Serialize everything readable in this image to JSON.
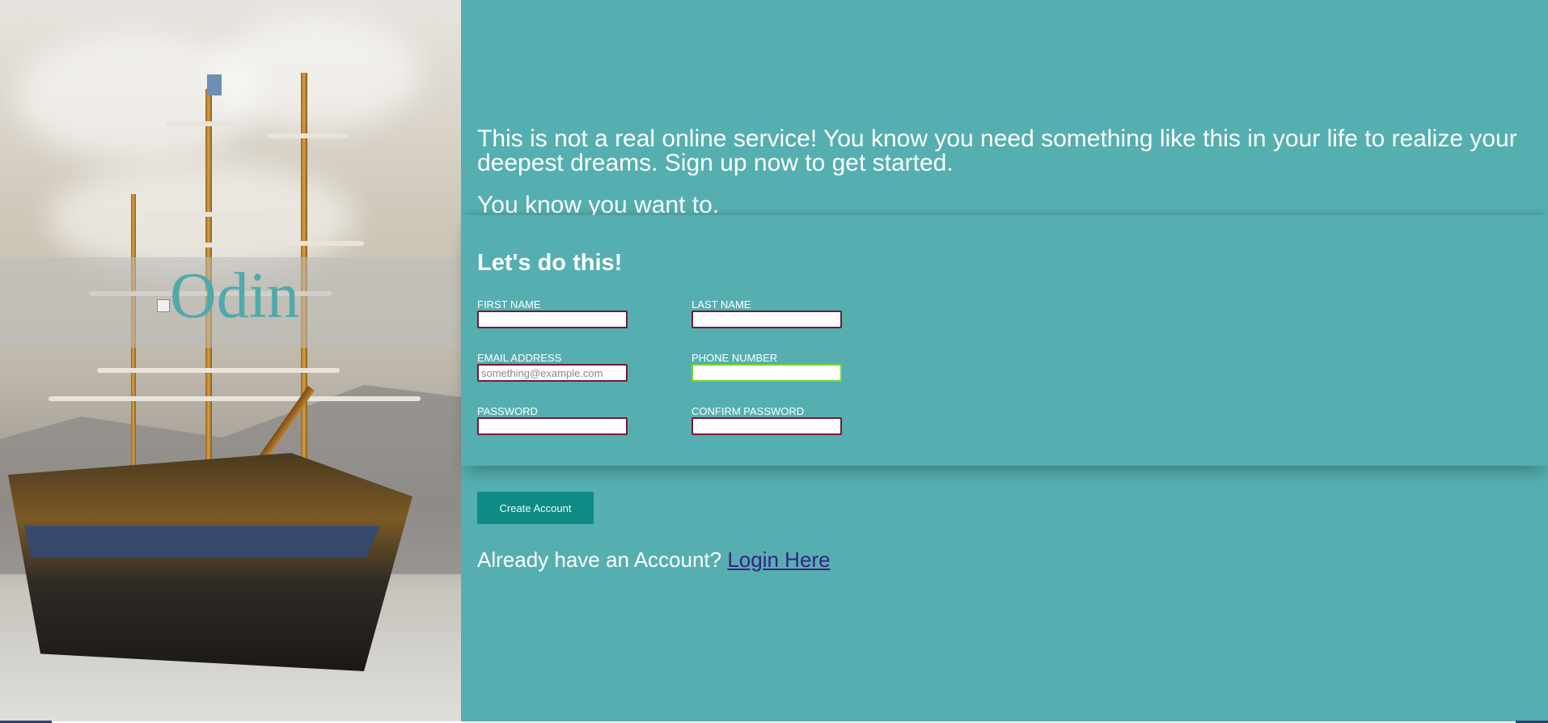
{
  "brand": {
    "name": "Odin",
    "accent_color": "#55afb0",
    "logo_icon": "broken-image-icon"
  },
  "intro": {
    "text": "This is not a real online service! You know you need something like this in your life to realize your deepest dreams. Sign up now to get started.",
    "subtext": "You know you want to."
  },
  "form": {
    "heading": "Let's do this!",
    "fields": {
      "first_name": {
        "label": "FIRST NAME",
        "value": "",
        "placeholder": ""
      },
      "last_name": {
        "label": "LAST NAME",
        "value": "",
        "placeholder": ""
      },
      "email": {
        "label": "EMAIL ADDRESS",
        "value": "",
        "placeholder": "something@example.com"
      },
      "phone": {
        "label": "PHONE NUMBER",
        "value": "",
        "placeholder": ""
      },
      "password": {
        "label": "PASSWORD",
        "value": "",
        "placeholder": ""
      },
      "confirm_password": {
        "label": "CONFIRM PASSWORD",
        "value": "",
        "placeholder": ""
      }
    },
    "invalid_border_color": "#7a1638",
    "valid_border_color": "#72d62e"
  },
  "actions": {
    "create_account_label": "Create Account",
    "button_color": "#0e8b84"
  },
  "login": {
    "prompt": "Already have an Account?",
    "link_label": "Login Here",
    "link_color": "#3b1f86"
  }
}
